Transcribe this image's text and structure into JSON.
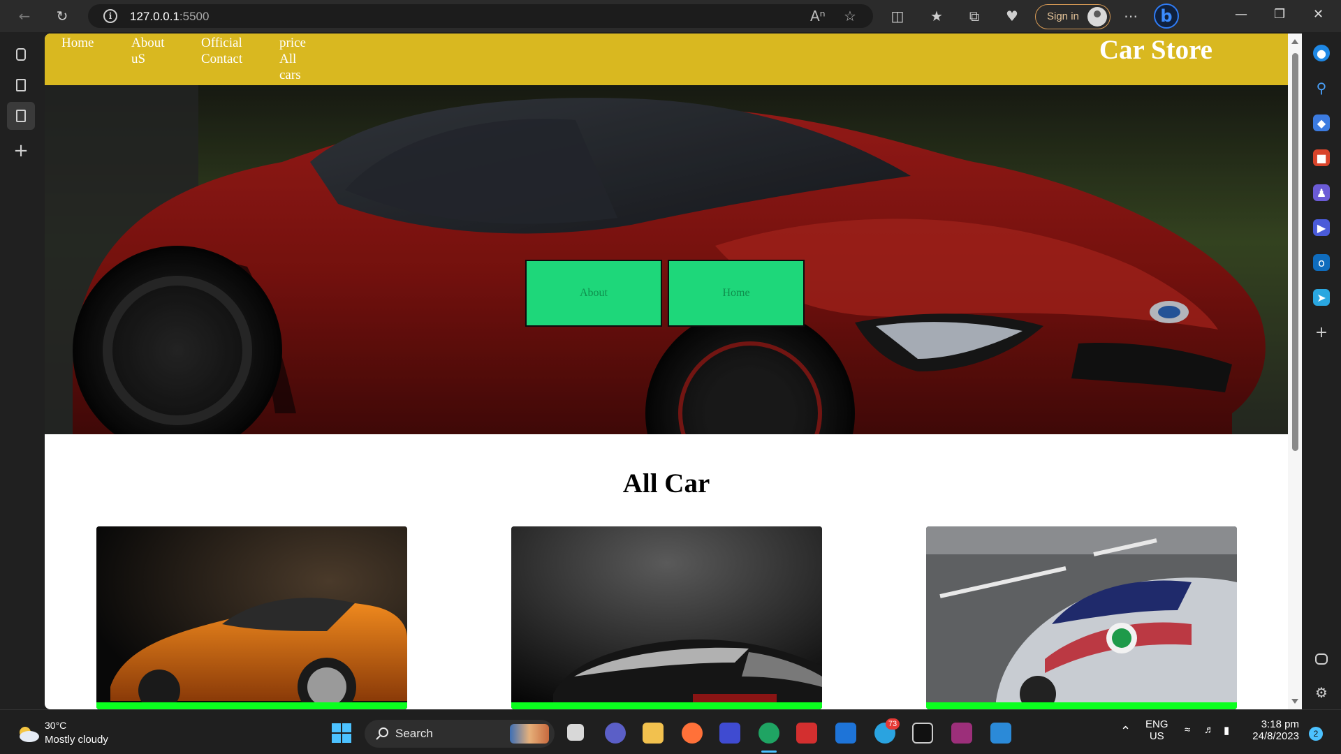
{
  "browser": {
    "url_host": "127.0.0.1",
    "url_port": ":5500",
    "signin_label": "Sign in"
  },
  "site": {
    "nav": [
      {
        "label": "Home"
      },
      {
        "label": "About uS"
      },
      {
        "label": "Official Contact"
      },
      {
        "label": "price All cars"
      }
    ],
    "brand": "Car Store",
    "hero_buttons": [
      {
        "label": "About"
      },
      {
        "label": "Home"
      }
    ],
    "section_title": "All Car",
    "nav_color": "#d9b820",
    "button_color": "#1ed77a",
    "card_bar_color": "#0bff1f"
  },
  "taskbar": {
    "weather_temp": "30°C",
    "weather_desc": "Mostly cloudy",
    "search_label": "Search",
    "telegram_badge": "73",
    "lang": "ENG",
    "region": "US",
    "time": "3:18 pm",
    "date": "24/8/2023",
    "notification_count": "2"
  }
}
